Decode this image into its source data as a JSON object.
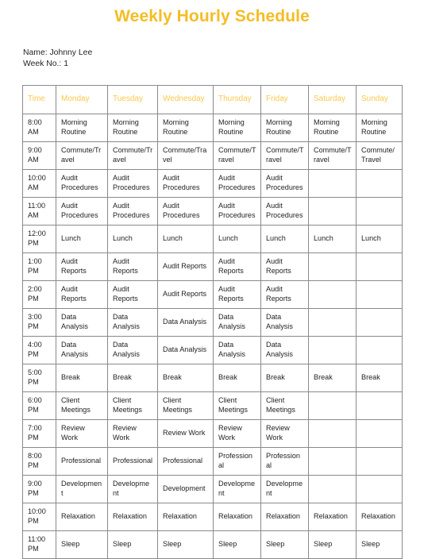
{
  "document": {
    "title": "Weekly Hourly Schedule",
    "title_color": "#f5bc24",
    "header_text_color": "#fbc94a",
    "border_color": "#8a8a8a",
    "body_text_color": "#231f20"
  },
  "meta": {
    "name_line": "Name: Johnny Lee",
    "week_line": "Week No.: 1"
  },
  "table": {
    "columns": [
      "Time",
      "Monday",
      "Tuesday",
      "Wednesday",
      "Thursday",
      "Friday",
      "Saturday",
      "Sunday"
    ],
    "rows": [
      {
        "time": "8:00 AM",
        "cells": [
          "Morning Routine",
          "Morning Routine",
          "Morning Routine",
          "Morning Routine",
          "Morning Routine",
          "Morning Routine",
          "Morning Routine"
        ]
      },
      {
        "time": "9:00 AM",
        "cells": [
          "Commute/Travel",
          "Commute/Travel",
          "Commute/Travel",
          "Commute/Travel",
          "Commute/Travel",
          "Commute/Travel",
          "Commute/Travel"
        ]
      },
      {
        "time": "10:00 AM",
        "cells": [
          "Audit Procedures",
          "Audit Procedures",
          "Audit Procedures",
          "Audit Procedures",
          "Audit Procedures",
          "",
          ""
        ]
      },
      {
        "time": "11:00 AM",
        "cells": [
          "Audit Procedures",
          "Audit Procedures",
          "Audit Procedures",
          "Audit Procedures",
          "Audit Procedures",
          "",
          ""
        ]
      },
      {
        "time": "12:00 PM",
        "cells": [
          "Lunch",
          "Lunch",
          "Lunch",
          "Lunch",
          "Lunch",
          "Lunch",
          "Lunch"
        ]
      },
      {
        "time": "1:00 PM",
        "cells": [
          "Audit Reports",
          "Audit Reports",
          "Audit Reports",
          "Audit Reports",
          "Audit Reports",
          "",
          ""
        ]
      },
      {
        "time": "2:00 PM",
        "cells": [
          "Audit Reports",
          "Audit Reports",
          "Audit Reports",
          "Audit Reports",
          "Audit Reports",
          "",
          ""
        ]
      },
      {
        "time": "3:00 PM",
        "cells": [
          "Data Analysis",
          "Data Analysis",
          "Data Analysis",
          "Data Analysis",
          "Data Analysis",
          "",
          ""
        ]
      },
      {
        "time": "4:00 PM",
        "cells": [
          "Data Analysis",
          "Data Analysis",
          "Data Analysis",
          "Data Analysis",
          "Data Analysis",
          "",
          ""
        ]
      },
      {
        "time": "5:00 PM",
        "cells": [
          "Break",
          "Break",
          "Break",
          "Break",
          "Break",
          "Break",
          "Break"
        ]
      },
      {
        "time": "6:00 PM",
        "cells": [
          "Client Meetings",
          "Client Meetings",
          "Client Meetings",
          "Client Meetings",
          "Client Meetings",
          "",
          ""
        ]
      },
      {
        "time": "7:00 PM",
        "cells": [
          "Review Work",
          "Review Work",
          "Review Work",
          "Review Work",
          "Review Work",
          "",
          ""
        ]
      },
      {
        "time": "8:00 PM",
        "cells": [
          "Professional",
          "Professional",
          "Professional",
          "Professional",
          "Professional",
          "",
          ""
        ]
      },
      {
        "time": "9:00 PM",
        "cells": [
          "Development",
          "Development",
          "Development",
          "Development",
          "Development",
          "",
          ""
        ]
      },
      {
        "time": "10:00 PM",
        "cells": [
          "Relaxation",
          "Relaxation",
          "Relaxation",
          "Relaxation",
          "Relaxation",
          "Relaxation",
          "Relaxation"
        ]
      },
      {
        "time": "11:00 PM",
        "cells": [
          "Sleep",
          "Sleep",
          "Sleep",
          "Sleep",
          "Sleep",
          "Sleep",
          "Sleep"
        ]
      }
    ]
  }
}
